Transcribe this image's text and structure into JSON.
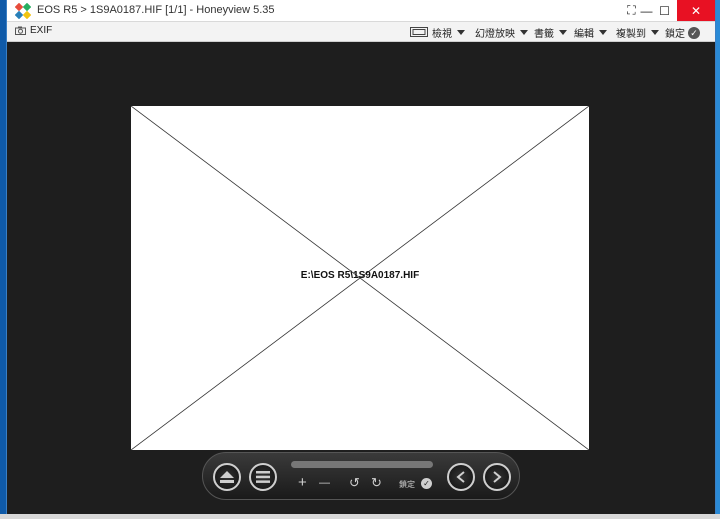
{
  "window": {
    "title": "EOS R5 > 1S9A0187.HIF [1/1] - Honeyview 5.35",
    "minimize": "—",
    "maximize": "☐",
    "close": "✕",
    "fullscreen": "⛶"
  },
  "toolbar": {
    "exif_label": "EXIF",
    "menus": [
      {
        "label": "檢視"
      },
      {
        "label": "幻燈放映"
      },
      {
        "label": "書籤"
      },
      {
        "label": "編輯"
      },
      {
        "label": "複製到"
      }
    ],
    "lock_label": "鎖定"
  },
  "viewer": {
    "missing_image_path": "E:\\EOS R5\\1S9A0187.HIF"
  },
  "controls": {
    "zoom_in": "+",
    "zoom_out": "—",
    "rotate_left": "↺",
    "rotate_right": "↻",
    "lock_label": "鎖定"
  },
  "colors": {
    "titlebar_bg": "#ffffff",
    "close_bg": "#e81123",
    "viewer_bg": "#1e1e1e",
    "control_bar_bg": "#2a2a2a"
  },
  "icons": [
    "app-icon",
    "camera-icon",
    "filmstrip-icon",
    "check-circle-icon",
    "eject-icon",
    "menu-icon",
    "prev-icon",
    "next-icon"
  ]
}
